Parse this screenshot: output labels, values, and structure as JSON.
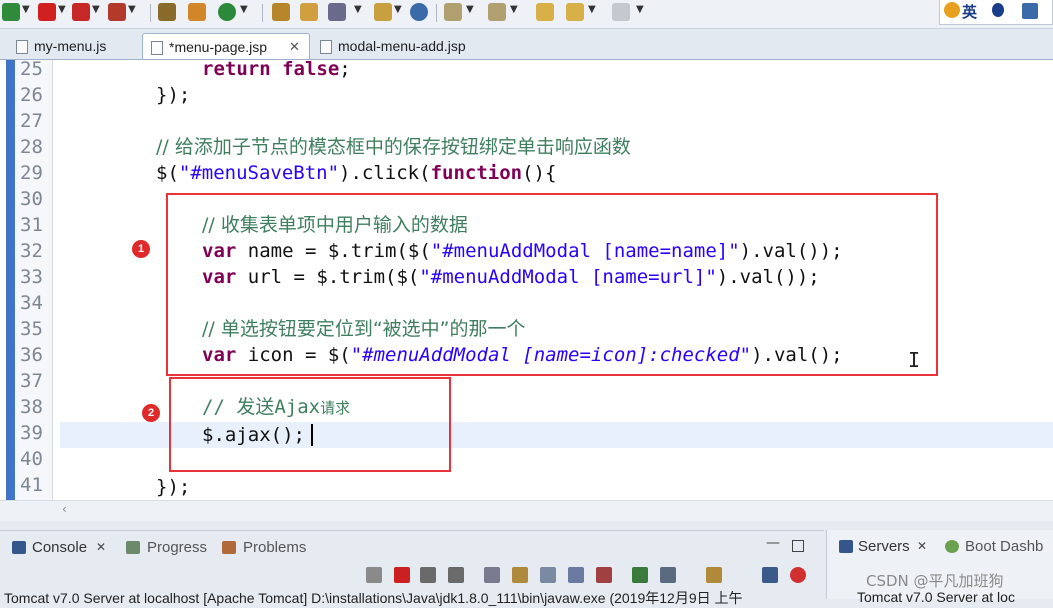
{
  "toolbar": {
    "lang_label": "英",
    "icons": [
      "debug-icon",
      "stop-icon",
      "run-icon",
      "server-icon",
      "refresh-icon",
      "open-folder-icon",
      "folder-icon",
      "wand-icon",
      "folder-open-icon",
      "globe-icon",
      "down-arrow-icon",
      "up-arrow-icon",
      "back-icon",
      "forward-icon"
    ]
  },
  "tabs": [
    {
      "label": "my-menu.js",
      "active": false
    },
    {
      "label": "*menu-page.jsp",
      "active": true
    },
    {
      "label": "modal-menu-add.jsp",
      "active": false
    }
  ],
  "editor": {
    "line_numbers": [
      "25",
      "26",
      "27",
      "28",
      "29",
      "30",
      "31",
      "32",
      "33",
      "34",
      "35",
      "36",
      "37",
      "38",
      "39",
      "40",
      "41"
    ],
    "current_line": "39"
  },
  "code": {
    "l25_kw": "return false",
    "l25_end": ";",
    "l26": "});",
    "l28": "// 给添加子节点的模态框中的保存按钮绑定单击响应函数",
    "l29_a": "$(",
    "l29_str": "\"#menuSaveBtn\"",
    "l29_b": ").click(",
    "l29_kw": "function",
    "l29_c": "(){",
    "l31": "// 收集表单项中用户输入的数据",
    "l32_kw": "var",
    "l32_a": " name = $.trim($(",
    "l32_str": "\"#menuAddModal [name=name]\"",
    "l32_b": ").val());",
    "l33_kw": "var",
    "l33_a": " url = $.trim($(",
    "l33_str": "\"#menuAddModal [name=url]\"",
    "l33_b": ").val());",
    "l35": "// 单选按钮要定位到“被选中”的那一个",
    "l36_kw": "var",
    "l36_a": " icon = $(",
    "l36_str": "\"#menuAddModal [name=icon]:checked\"",
    "l36_b": ").val();",
    "l38_a": "// 发送Ajax",
    "l38_b": "请求",
    "l39": "$.ajax();",
    "l41": "});"
  },
  "annotations": {
    "badge1": "1",
    "badge2": "2",
    "box_color": "#e8333a"
  },
  "bottom": {
    "tabs": [
      {
        "label": "Console",
        "active": true
      },
      {
        "label": "Progress",
        "active": false
      },
      {
        "label": "Problems",
        "active": false
      }
    ],
    "right_tabs": [
      {
        "label": "Servers",
        "active": true
      },
      {
        "label": "Boot Dashb",
        "active": false
      }
    ],
    "console_text": "Tomcat v7.0 Server at localhost [Apache Tomcat] D:\\installations\\Java\\jdk1.8.0_111\\bin\\javaw.exe (2019年12月9日 上午",
    "right_console_text": "Tomcat v7.0 Server at loc"
  },
  "watermark": "CSDN @平凡加班狗"
}
